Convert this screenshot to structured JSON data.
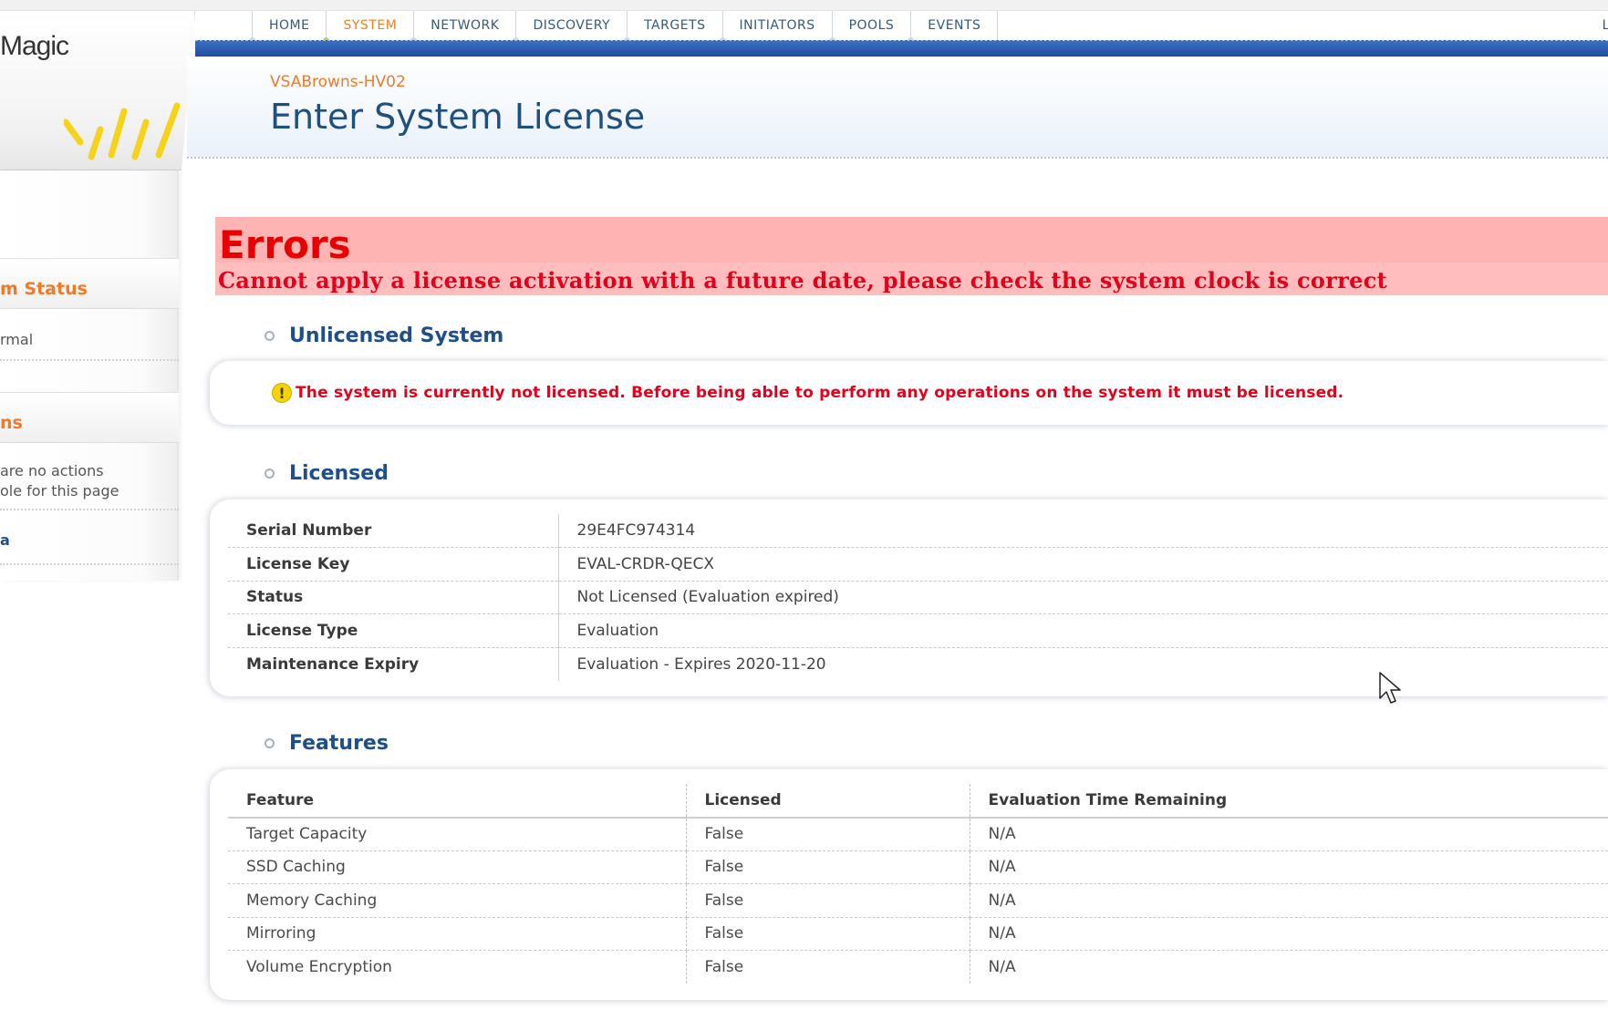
{
  "brand": {
    "logo_text": "Magic"
  },
  "nav": {
    "items": [
      "HOME",
      "SYSTEM",
      "NETWORK",
      "DISCOVERY",
      "TARGETS",
      "INITIATORS",
      "POOLS",
      "EVENTS"
    ],
    "active": "SYSTEM",
    "right_text": "La"
  },
  "header": {
    "host": "VSABrowns-HV02",
    "title": "Enter System License"
  },
  "sidebar": {
    "status_title": "m Status",
    "status_value": "rmal",
    "actions_title": "ns",
    "actions_text_1": "are no actions",
    "actions_text_2": "ole for this page",
    "footer_link": "a"
  },
  "errors": {
    "title": "Errors",
    "message": "Cannot apply a license activation with a future date, please check the system clock is correct"
  },
  "unlicensed": {
    "title": "Unlicensed System",
    "warning": "The system is currently not licensed. Before being able to perform any operations on the system it must be licensed."
  },
  "licensed": {
    "title": "Licensed",
    "rows": [
      {
        "label": "Serial Number",
        "value": "29E4FC974314"
      },
      {
        "label": "License Key",
        "value": "EVAL-CRDR-QECX"
      },
      {
        "label": "Status",
        "value": "Not Licensed (Evaluation expired)"
      },
      {
        "label": "License Type",
        "value": "Evaluation"
      },
      {
        "label": "Maintenance Expiry",
        "value": "Evaluation - Expires 2020-11-20"
      }
    ]
  },
  "features": {
    "title": "Features",
    "headers": [
      "Feature",
      "Licensed",
      "Evaluation Time Remaining"
    ],
    "rows": [
      [
        "Target Capacity",
        "False",
        "N/A"
      ],
      [
        "SSD Caching",
        "False",
        "N/A"
      ],
      [
        "Memory Caching",
        "False",
        "N/A"
      ],
      [
        "Mirroring",
        "False",
        "N/A"
      ],
      [
        "Volume Encryption",
        "False",
        "N/A"
      ]
    ]
  },
  "colors": {
    "accent_orange": "#f07a2a",
    "nav_blue": "#1d4c9e",
    "title_blue": "#1f4f7f",
    "error_red": "#e3001b",
    "error_bg": "#ffbdbd"
  }
}
